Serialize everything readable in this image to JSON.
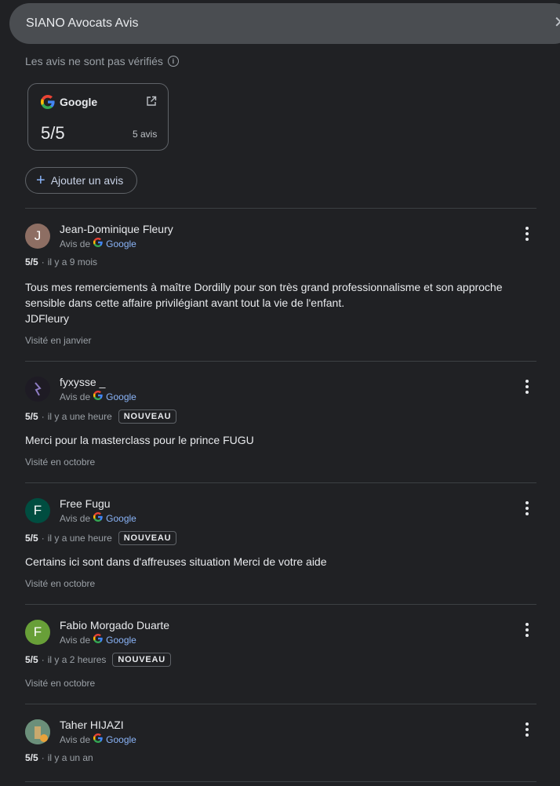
{
  "header": {
    "title": "SIANO Avocats Avis",
    "close_label": "✕"
  },
  "notice": {
    "text": "Les avis ne sont pas vérifiés",
    "info_icon": "i"
  },
  "summary_card": {
    "source": "Google",
    "score": "5/5",
    "count": "5 avis"
  },
  "add_review": {
    "label": "Ajouter un avis",
    "icon": "+"
  },
  "reviews": [
    {
      "avatar": "J",
      "avatar_color": "#8d6e63",
      "name": "Jean-Dominique Fleury",
      "source_prefix": "Avis de",
      "source": "Google",
      "rating": "5/5",
      "time": "il y a 9 mois",
      "badge": "",
      "text": "Tous mes remerciements à maître Dordilly pour son très grand professionnalisme et son approche sensible dans cette affaire privilégiant avant tout la vie de l'enfant.\nJDFleury",
      "visited": "Visité en janvier"
    },
    {
      "avatar": "",
      "avatar_color": "#1e1b24",
      "name": "fyxysse _",
      "source_prefix": "Avis de",
      "source": "Google",
      "rating": "5/5",
      "time": "il y a une heure",
      "badge": "NOUVEAU",
      "text": "Merci pour la masterclass pour le prince FUGU",
      "visited": "Visité en octobre"
    },
    {
      "avatar": "F",
      "avatar_color": "#004d40",
      "name": "Free Fugu",
      "source_prefix": "Avis de",
      "source": "Google",
      "rating": "5/5",
      "time": "il y a une heure",
      "badge": "NOUVEAU",
      "text": "Certains ici sont dans d'affreuses situation Merci de votre aide",
      "visited": "Visité en octobre"
    },
    {
      "avatar": "F",
      "avatar_color": "#689f38",
      "name": "Fabio Morgado Duarte",
      "source_prefix": "Avis de",
      "source": "Google",
      "rating": "5/5",
      "time": "il y a 2 heures",
      "badge": "NOUVEAU",
      "text": "",
      "visited": "Visité en octobre"
    },
    {
      "avatar": "",
      "avatar_color": "#5a7a6a",
      "name": "Taher HIJAZI",
      "source_prefix": "Avis de",
      "source": "Google",
      "rating": "5/5",
      "time": "il y a un an",
      "badge": "",
      "text": "",
      "visited": ""
    }
  ],
  "icons": {
    "google": "google-g-icon",
    "external": "open-external-icon",
    "menu": "more-vert-icon"
  },
  "colors": {
    "background": "#202124",
    "accent": "#8ab4f8"
  }
}
